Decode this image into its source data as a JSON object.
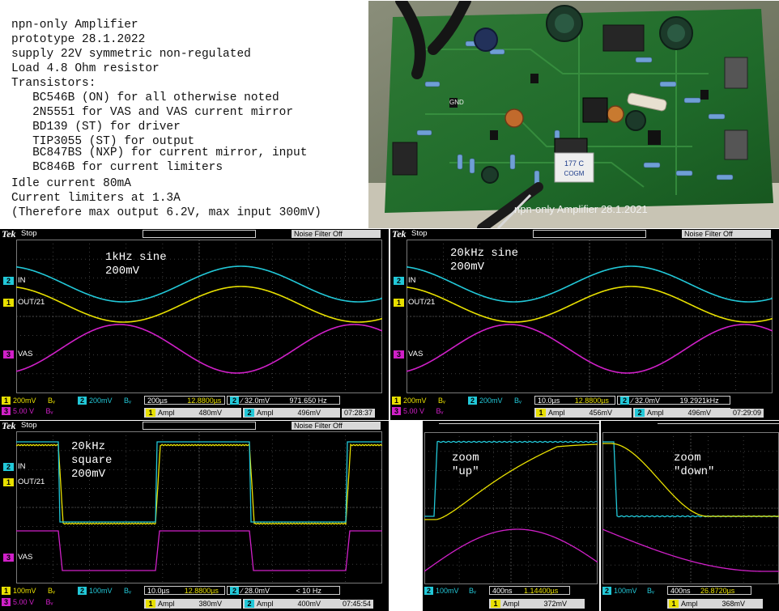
{
  "notes": {
    "lines": [
      "npn-only Amplifier",
      "prototype 28.1.2022",
      "supply 22V symmetric non-regulated",
      "Load 4.8 Ohm resistor",
      "Transistors:",
      "   BC546B (ON) for all otherwise noted",
      "   2N5551 for VAS and VAS current mirror",
      "   BD139 (ST) for driver",
      "   TIP3055 (ST) for output",
      "   BC847BS (NXP) for current mirror, input",
      "   BC846B for current limiters",
      "Idle current 80mA",
      "Current limiters at 1.3A",
      "(Therefore max output 6.2V, max input 300mV)"
    ]
  },
  "photo": {
    "board_labels": {
      "pcb_text": "npn-only Amplifier 28.1.2021",
      "gnd": "GND",
      "sticker_top": "177 C",
      "sticker_bottom": "COGM"
    }
  },
  "scopes": [
    {
      "brand": "Tek",
      "state": "Stop",
      "noise_filter": "Noise Filter Off",
      "annotation": [
        "1kHz sine",
        "200mV"
      ],
      "channels": {
        "ch2": "IN",
        "ch1": "OUT/21",
        "ch3": "VAS"
      },
      "readout": {
        "ch1_scale": "200mV",
        "ch1_bw": "Bᵥ",
        "ch2_scale": "200mV",
        "ch2_bw": "Bᵥ",
        "ch3_scale": "5.00 V",
        "ch3_bw": "Bᵥ",
        "timebase": "200µs",
        "delay": "12.8800µs",
        "trigger": "∕ 32.0mV",
        "frequency": "971.650 Hz",
        "ampl1_label": "Ampl",
        "ampl1_value": "480mV",
        "ampl2_label": "Ampl",
        "ampl2_value": "496mV",
        "time": "07:28:37"
      }
    },
    {
      "brand": "Tek",
      "state": "Stop",
      "noise_filter": "Noise Filter Off",
      "annotation": [
        "20kHz sine",
        "200mV"
      ],
      "channels": {
        "ch2": "IN",
        "ch1": "OUT/21",
        "ch3": "VAS"
      },
      "readout": {
        "ch1_scale": "200mV",
        "ch1_bw": "Bᵥ",
        "ch2_scale": "200mV",
        "ch2_bw": "Bᵥ",
        "ch3_scale": "5.00 V",
        "ch3_bw": "Bᵥ",
        "timebase": "10.0µs",
        "delay": "12.8800µs",
        "trigger": "∕ 32.0mV",
        "frequency": "19.2921kHz",
        "ampl1_label": "Ampl",
        "ampl1_value": "456mV",
        "ampl2_label": "Ampl",
        "ampl2_value": "496mV",
        "time": "07:29:09"
      }
    },
    {
      "brand": "Tek",
      "state": "Stop",
      "noise_filter": "Noise Filter Off",
      "annotation": [
        "20kHz",
        "square",
        "200mV"
      ],
      "channels": {
        "ch2": "IN",
        "ch1": "OUT/21",
        "ch3": "VAS"
      },
      "readout": {
        "ch1_scale": "100mV",
        "ch1_bw": "Bᵥ",
        "ch2_scale": "100mV",
        "ch2_bw": "Bᵥ",
        "ch3_scale": "5.00 V",
        "ch3_bw": "Bᵥ",
        "timebase": "10.0µs",
        "delay": "12.8800µs",
        "trigger": "∕ 28.0mV",
        "frequency": "< 10 Hz",
        "ampl1_label": "Ampl",
        "ampl1_value": "380mV",
        "ampl2_label": "Ampl",
        "ampl2_value": "400mV",
        "time": "07:45:54"
      }
    },
    {
      "annotation": [
        "zoom",
        "\"up\""
      ],
      "readout": {
        "ch2_scale": "100mV",
        "ch2_bw": "Bᵥ",
        "timebase": "400ns",
        "delay": "1.14400µs",
        "ampl1_label": "Ampl",
        "ampl1_value": "372mV"
      }
    },
    {
      "annotation": [
        "zoom",
        "\"down\""
      ],
      "readout": {
        "ch2_scale": "100mV",
        "ch2_bw": "Bᵥ",
        "timebase": "400ns",
        "delay": "26.8720µs",
        "ampl1_label": "Ampl",
        "ampl1_value": "368mV"
      }
    }
  ],
  "colors": {
    "ch1": "#e8e000",
    "ch2": "#22c8d8",
    "ch3": "#d020c8",
    "grid": "#7a7a7a"
  }
}
